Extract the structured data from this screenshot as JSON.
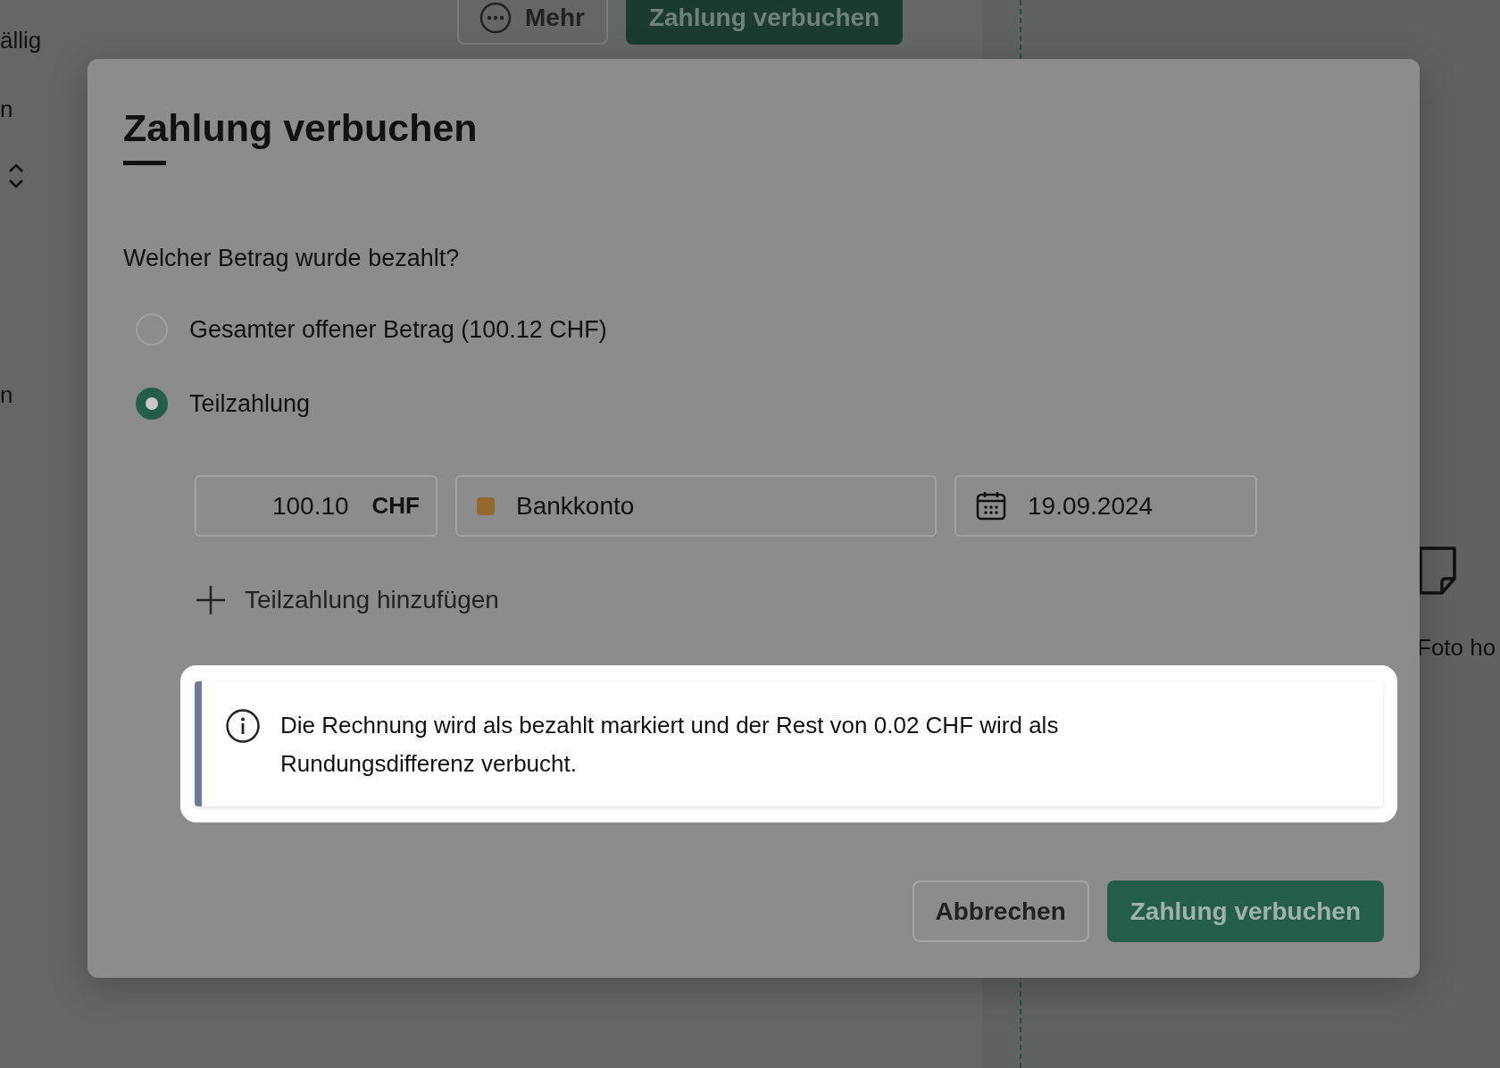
{
  "background": {
    "sidebar_items": [
      {
        "label": "ällig"
      },
      {
        "label": "n"
      },
      {
        "label": "n"
      }
    ],
    "toolbar_buttons": [
      {
        "label": "Mehr",
        "kind": "secondary"
      },
      {
        "label": "Zahlung verbuchen",
        "kind": "primary"
      }
    ],
    "side_panel": {
      "label": "Foto ho"
    }
  },
  "dialog": {
    "title": "Zahlung verbuchen",
    "question": "Welcher Betrag wurde bezahlt?",
    "options": [
      {
        "label": "Gesamter offener Betrag (100.12 CHF)",
        "selected": false
      },
      {
        "label": "Teilzahlung",
        "selected": true
      }
    ],
    "payment": {
      "amount": "100.10",
      "currency": "CHF",
      "account": {
        "label": "Bankkonto",
        "color": "#93682f"
      },
      "date": "19.09.2024"
    },
    "add_label": "Teilzahlung hinzufügen",
    "info": {
      "text": "Die Rechnung wird als bezahlt markiert und der Rest von 0.02 CHF wird als Rundungsdifferenz verbucht.",
      "highlighted": true
    },
    "buttons": [
      {
        "label": "Abbrechen",
        "kind": "secondary"
      },
      {
        "label": "Zahlung verbuchen",
        "kind": "primary"
      }
    ]
  }
}
